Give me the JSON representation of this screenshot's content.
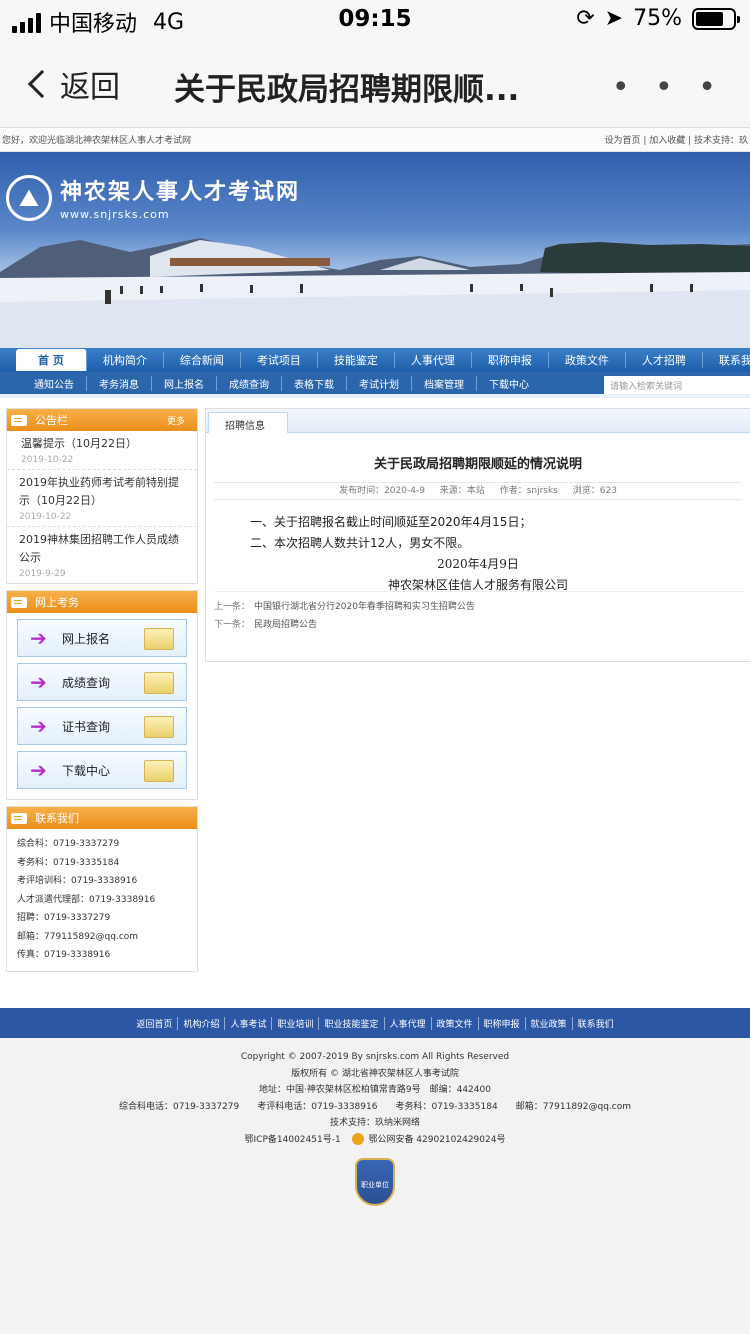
{
  "status": {
    "carrier": "中国移动",
    "network": "4G",
    "time": "09:15",
    "battery": "75%",
    "battery_level": 0.75
  },
  "nav": {
    "back_label": "返回",
    "title": "关于民政局招聘期限顺...",
    "more": "• • •"
  },
  "site": {
    "welcome": "您好，欢迎光临湖北神农架林区人事人才考试网",
    "top_links": "设为首页 | 加入收藏 | 技术支持：玖",
    "logo_cn": "神农架人事人才考试网",
    "logo_en": "www.snjrsks.com",
    "main_nav": [
      "首 页",
      "机构简介",
      "综合新闻",
      "考试项目",
      "技能鉴定",
      "人事代理",
      "职称申报",
      "政策文件",
      "人才招聘",
      "联系我"
    ],
    "sub_nav": [
      "通知公告",
      "考务消息",
      "网上报名",
      "成绩查询",
      "表格下载",
      "考试计划",
      "档案管理",
      "下载中心"
    ],
    "search_placeholder": "请输入检索关键词"
  },
  "sidebar": {
    "notice_title": "公告栏",
    "notice_more": "更多",
    "notices": [
      {
        "title": "温馨提示（10月22日）",
        "date": "2019-10-22"
      },
      {
        "title": "2019年执业药师考试考前特别提示（10月22日）",
        "date": "2019-10-22"
      },
      {
        "title": "2019神林集团招聘工作人员成绩公示",
        "date": "2019-9-29"
      }
    ],
    "online_title": "网上考务",
    "online_items": [
      "网上报名",
      "成绩查询",
      "证书查询",
      "下载中心"
    ],
    "contact_title": "联系我们",
    "contacts": [
      "综合科：0719-3337279",
      "考务科：0719-3335184",
      "考评培训科：0719-3338916",
      "人才派遣代理部：0719-3338916",
      "招聘：0719-3337279",
      "邮箱：779115892@qq.com",
      "传真：0719-3338916"
    ]
  },
  "article": {
    "tab": "招聘信息",
    "title": "关于民政局招聘期限顺延的情况说明",
    "meta_time": "发布时间：2020-4-9",
    "meta_source": "来源：本站",
    "meta_author": "作者：snjrsks",
    "meta_views": "浏览：623",
    "para1": "一、关于招聘报名截止时间顺延至2020年4月15日；",
    "para2": "二、本次招聘人数共计12人，男女不限。",
    "date": "2020年4月9日",
    "org": "神农架林区佳信人才服务有限公司",
    "prev_label": "上一条：",
    "prev_text": "中国银行湖北省分行2020年春季招聘和实习生招聘公告",
    "next_label": "下一条：",
    "next_text": "民政局招聘公告"
  },
  "footer": {
    "links": [
      "返回首页",
      "机构介绍",
      "人事考试",
      "职业培训",
      "职业技能鉴定",
      "人事代理",
      "政策文件",
      "职称申报",
      "就业政策",
      "联系我们"
    ],
    "copyright": "Copyright © 2007-2019 By snjrsks.com All Rights Reserved",
    "owner": "版权所有 © 湖北省神农架林区人事考试院",
    "address": "地址：中国·神农架林区松柏镇常青路9号　邮编：442400",
    "phones": "综合科电话：0719-3337279　　考评科电话：0719-3338916　　考务科：0719-3335184　　邮箱：77911892@qq.com",
    "tech": "技术支持：玖纳米网络",
    "icp": "鄂ICP备14002451号-1",
    "police": "鄂公网安备 42902102429024号",
    "badge": "职业单位"
  }
}
